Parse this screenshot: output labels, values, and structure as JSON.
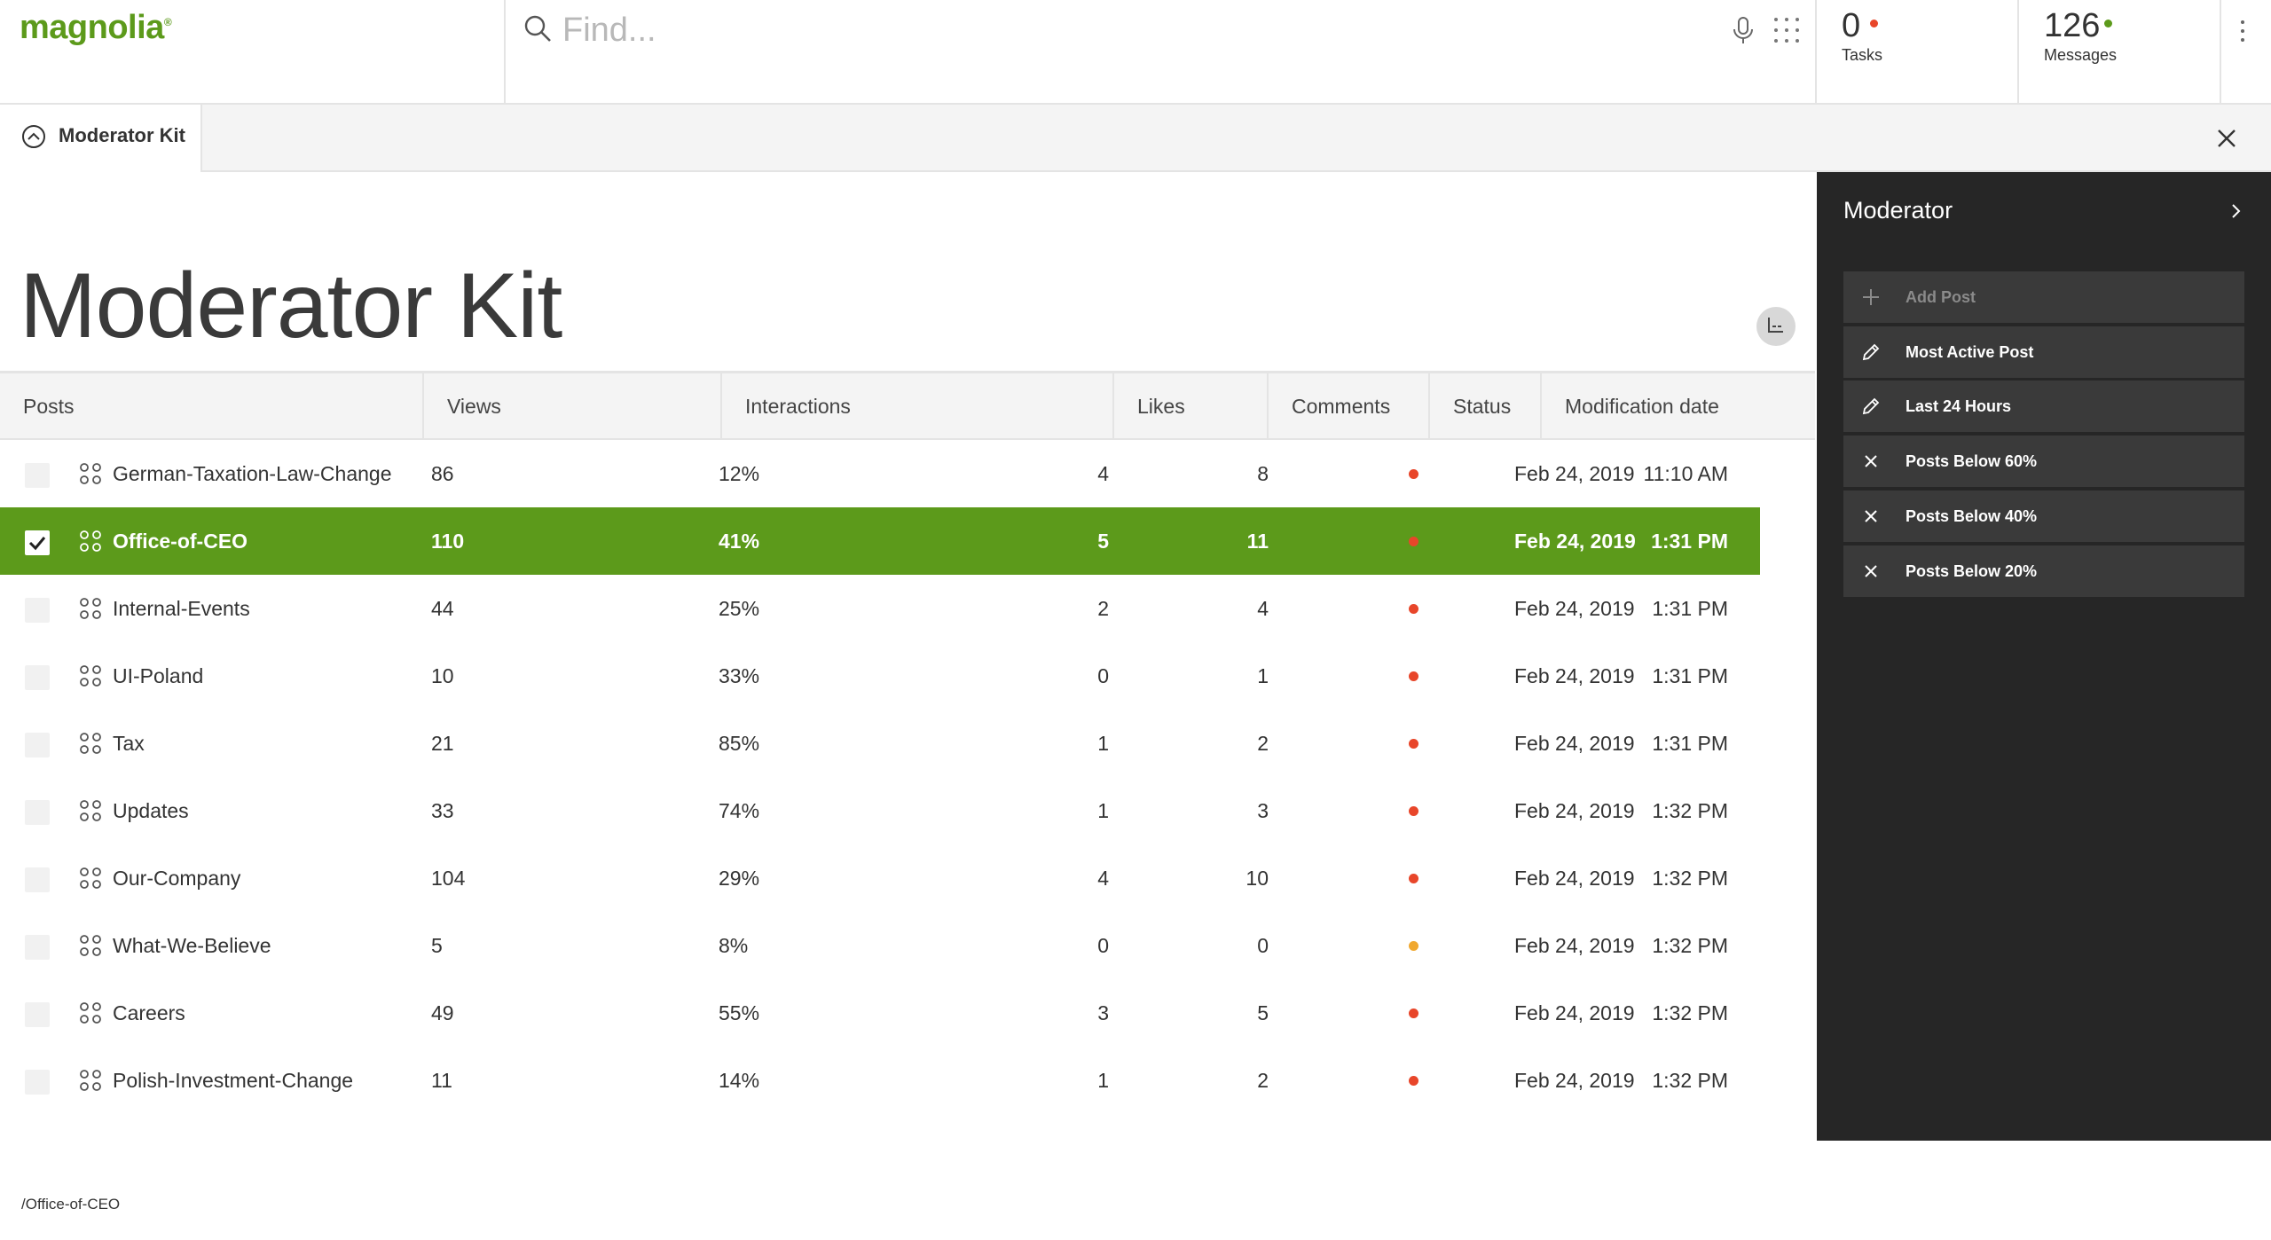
{
  "header": {
    "logo": "magnolia",
    "search_placeholder": "Find...",
    "tasks": {
      "count": "0",
      "label": "Tasks",
      "dot_color": "#e8462a"
    },
    "messages": {
      "count": "126",
      "label": "Messages",
      "dot_color": "#5c9a1b"
    }
  },
  "tab": {
    "label": "Moderator Kit"
  },
  "main": {
    "title": "Moderator Kit",
    "columns": [
      "Posts",
      "Views",
      "Interactions",
      "Likes",
      "Comments",
      "Status",
      "Modification date"
    ],
    "rows": [
      {
        "name": "German-Taxation-Law-Change",
        "views": "86",
        "interactions": "12%",
        "likes": "4",
        "comments": "8",
        "status": "red",
        "date": "Feb 24, 2019",
        "time": "11:10 AM",
        "selected": false
      },
      {
        "name": "Office-of-CEO",
        "views": "110",
        "interactions": "41%",
        "likes": "5",
        "comments": "11",
        "status": "red",
        "date": "Feb 24, 2019",
        "time": "1:31 PM",
        "selected": true
      },
      {
        "name": "Internal-Events",
        "views": "44",
        "interactions": "25%",
        "likes": "2",
        "comments": "4",
        "status": "red",
        "date": "Feb 24, 2019",
        "time": "1:31 PM",
        "selected": false
      },
      {
        "name": "UI-Poland",
        "views": "10",
        "interactions": "33%",
        "likes": "0",
        "comments": "1",
        "status": "red",
        "date": "Feb 24, 2019",
        "time": "1:31 PM",
        "selected": false
      },
      {
        "name": "Tax",
        "views": "21",
        "interactions": "85%",
        "likes": "1",
        "comments": "2",
        "status": "red",
        "date": "Feb 24, 2019",
        "time": "1:31 PM",
        "selected": false
      },
      {
        "name": "Updates",
        "views": "33",
        "interactions": "74%",
        "likes": "1",
        "comments": "3",
        "status": "red",
        "date": "Feb 24, 2019",
        "time": "1:32 PM",
        "selected": false
      },
      {
        "name": "Our-Company",
        "views": "104",
        "interactions": "29%",
        "likes": "4",
        "comments": "10",
        "status": "red",
        "date": "Feb 24, 2019",
        "time": "1:32 PM",
        "selected": false
      },
      {
        "name": "What-We-Believe",
        "views": "5",
        "interactions": "8%",
        "likes": "0",
        "comments": "0",
        "status": "orange",
        "date": "Feb 24, 2019",
        "time": "1:32 PM",
        "selected": false
      },
      {
        "name": "Careers",
        "views": "49",
        "interactions": "55%",
        "likes": "3",
        "comments": "5",
        "status": "red",
        "date": "Feb 24, 2019",
        "time": "1:32 PM",
        "selected": false
      },
      {
        "name": "Polish-Investment-Change",
        "views": "11",
        "interactions": "14%",
        "likes": "1",
        "comments": "2",
        "status": "red",
        "date": "Feb 24, 2019",
        "time": "1:32 PM",
        "selected": false
      }
    ],
    "path": "/Office-of-CEO"
  },
  "status_colors": {
    "red": "#e8462a",
    "orange": "#f0a830"
  },
  "accent": "#5c9a1b",
  "panel": {
    "title": "Moderator",
    "actions": [
      {
        "label": "Add Post",
        "icon": "plus-icon",
        "disabled": true
      },
      {
        "label": "Most Active Post",
        "icon": "pencil-icon",
        "disabled": false
      },
      {
        "label": "Last 24 Hours",
        "icon": "pencil-icon",
        "disabled": false
      },
      {
        "label": "Posts Below 60%",
        "icon": "x-icon",
        "disabled": false
      },
      {
        "label": "Posts Below 40%",
        "icon": "x-icon",
        "disabled": false
      },
      {
        "label": "Posts Below 20%",
        "icon": "x-icon",
        "disabled": false
      }
    ]
  }
}
